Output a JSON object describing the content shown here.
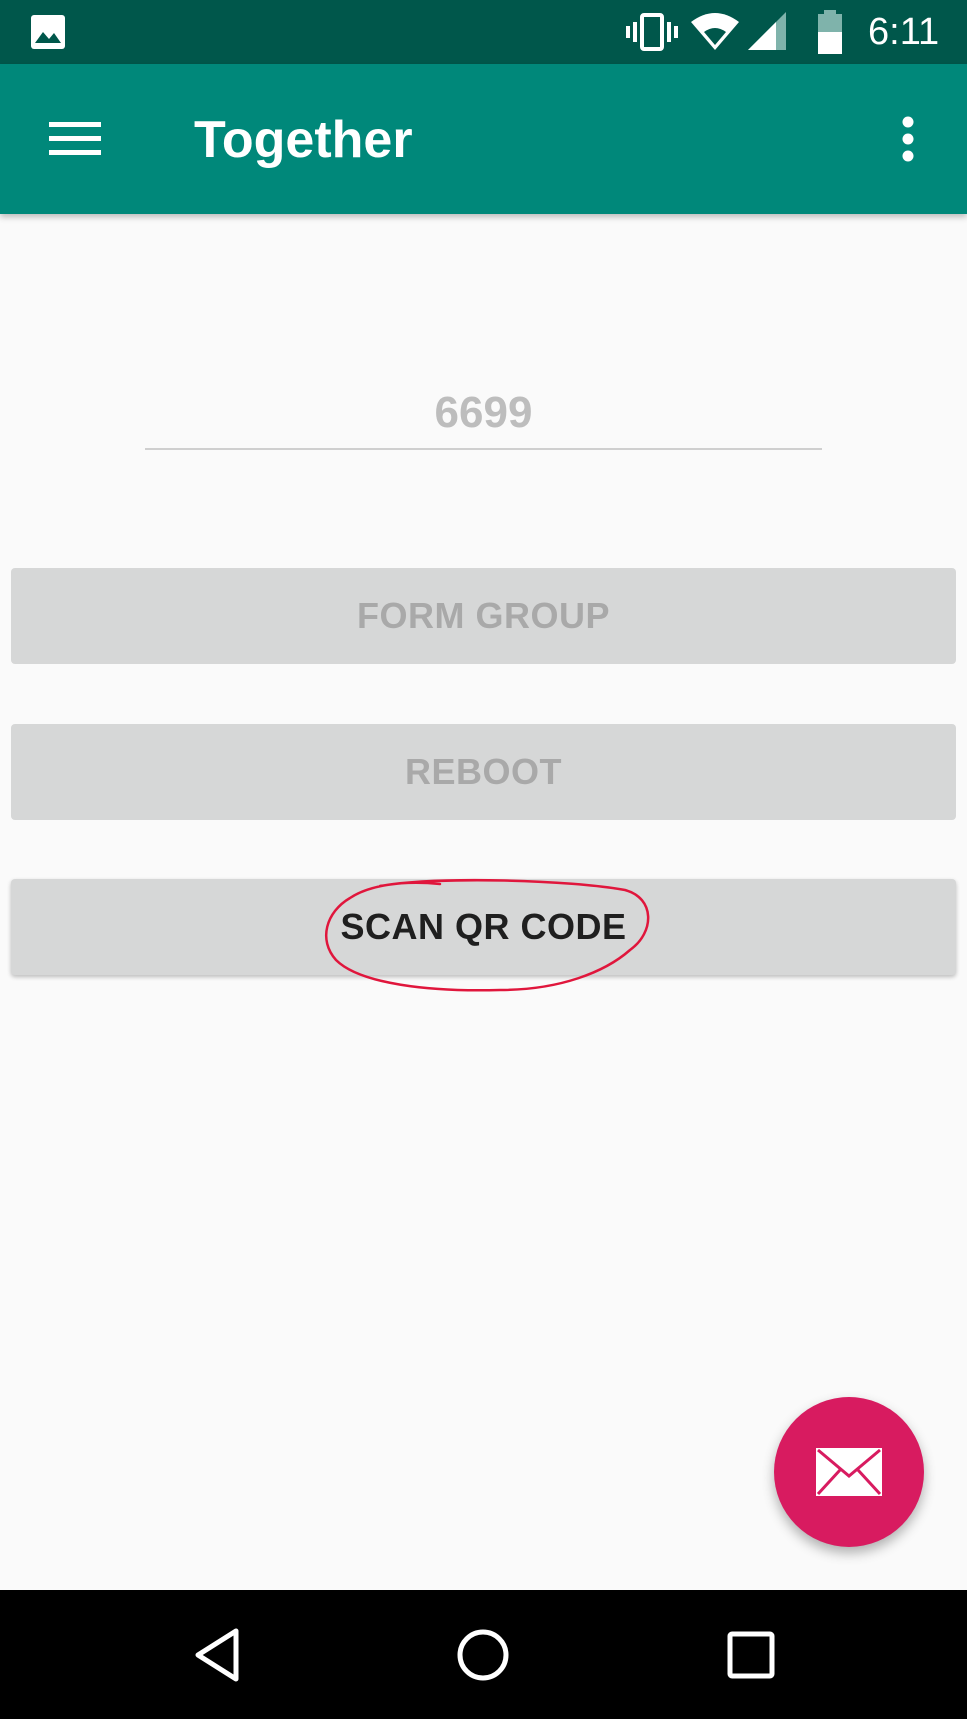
{
  "status_bar": {
    "time": "6:11",
    "icons": [
      "gallery-icon",
      "vibrate-icon",
      "wifi-icon",
      "signal-icon",
      "battery-icon"
    ]
  },
  "app_bar": {
    "title": "Together",
    "menu_icon": "menu-icon",
    "overflow_icon": "more-vert-icon"
  },
  "main": {
    "number_field": {
      "value": "6699"
    },
    "buttons": {
      "form_group": "FORM GROUP",
      "reboot": "REBOOT",
      "scan_qr": "SCAN QR CODE"
    },
    "annotation_color": "#e0163c"
  },
  "fab": {
    "icon": "mail-icon",
    "color": "#d81b60"
  },
  "nav_bar": {
    "icons": [
      "back-icon",
      "home-icon",
      "recents-icon"
    ]
  },
  "colors": {
    "status_bar": "#00574b",
    "app_bar": "#00887a",
    "button_bg": "#d6d7d7",
    "background": "#fafafa"
  }
}
